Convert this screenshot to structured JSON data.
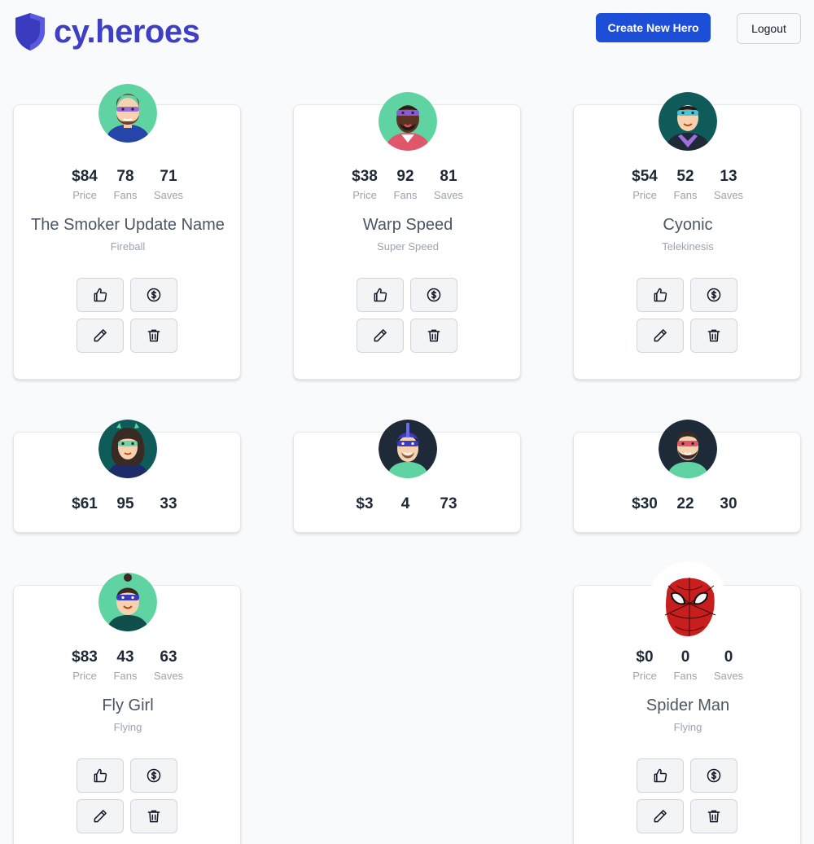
{
  "header": {
    "logo_text": "cy.heroes",
    "create_label": "Create New Hero",
    "logout_label": "Logout"
  },
  "labels": {
    "price": "Price",
    "fans": "Fans",
    "saves": "Saves"
  },
  "heroes": [
    {
      "price": "$84",
      "fans": "78",
      "saves": "71",
      "name": "The Smoker Update Name",
      "power": "Fireball"
    },
    {
      "price": "$38",
      "fans": "92",
      "saves": "81",
      "name": "Warp Speed",
      "power": "Super Speed"
    },
    {
      "price": "$54",
      "fans": "52",
      "saves": "13",
      "name": "Cyonic",
      "power": "Telekinesis"
    },
    {
      "price": "$61",
      "fans": "95",
      "saves": "33"
    },
    {
      "price": "$3",
      "fans": "4",
      "saves": "73"
    },
    {
      "price": "$30",
      "fans": "22",
      "saves": "30"
    },
    {
      "price": "$83",
      "fans": "43",
      "saves": "63",
      "name": "Fly Girl",
      "power": "Flying"
    },
    {
      "price": "$0",
      "fans": "0",
      "saves": "0",
      "name": "Spider Man",
      "power": "Flying"
    }
  ],
  "colors": {
    "brand": "#3f3fc4",
    "primary_button": "#1d4ed8"
  },
  "icons": [
    "shield-logo-icon",
    "thumbs-up-icon",
    "dollar-icon",
    "pencil-icon",
    "trash-icon"
  ]
}
